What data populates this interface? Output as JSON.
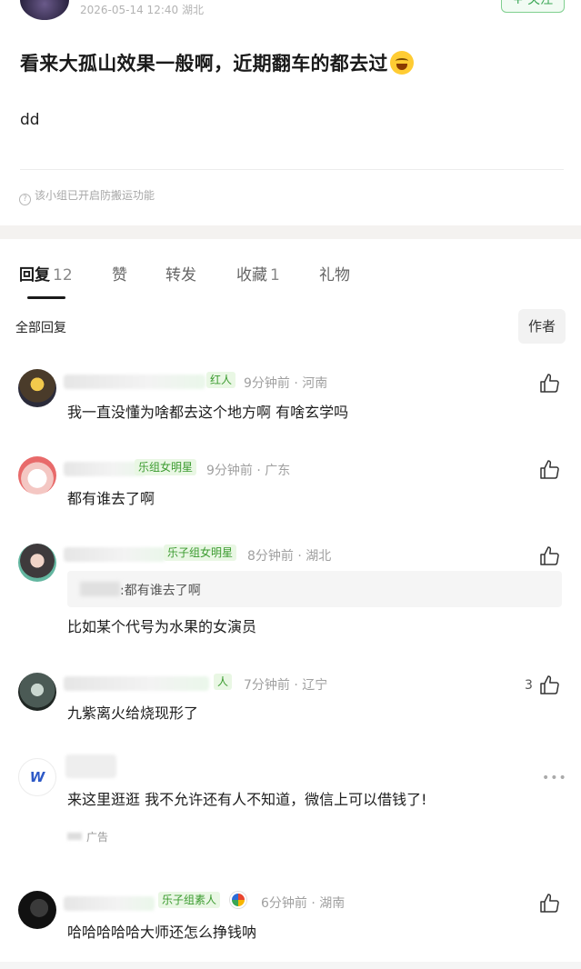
{
  "post": {
    "time_location": "2026-05-14 12:40  湖北",
    "follow_label": "+ 关注",
    "title": "看来大孤山效果一般啊，近期翻车的都去过",
    "body": "dd",
    "notice": "该小组已开启防搬运功能"
  },
  "tabs": [
    {
      "label": "回复",
      "count": "12"
    },
    {
      "label": "赞",
      "count": ""
    },
    {
      "label": "转发",
      "count": ""
    },
    {
      "label": "收藏",
      "count": "1"
    },
    {
      "label": "礼物",
      "count": ""
    }
  ],
  "filter": {
    "all_label": "全部回复",
    "author_label": "作者"
  },
  "comments": [
    {
      "badge": "红人",
      "meta": "9分钟前 · 河南",
      "text": "我一直没懂为啥都去这个地方啊 有啥玄学吗",
      "likes": ""
    },
    {
      "badge": "乐组女明星",
      "meta": "9分钟前 · 广东",
      "text": "都有谁去了啊",
      "likes": ""
    },
    {
      "badge": "乐子组女明星",
      "meta": "8分钟前 · 湖北",
      "quote": ":都有谁去了啊",
      "text": "比如某个代号为水果的女演员",
      "likes": ""
    },
    {
      "badge": "人",
      "meta": "7分钟前 · 辽宁",
      "text": "九紫离火给烧现形了",
      "likes": "3"
    },
    {
      "badge": "乐子组素人",
      "meta": "6分钟前 · 湖南",
      "text": "哈哈哈哈哈大师还怎么挣钱呐",
      "likes": ""
    }
  ],
  "ad": {
    "logo": "W",
    "text": "来这里逛逛 我不允许还有人不知道，微信上可以借钱了!",
    "tag": "广告",
    "more": "•••"
  },
  "icons": {
    "like": "thumbs-up-icon",
    "notice": "info-circle-icon"
  }
}
